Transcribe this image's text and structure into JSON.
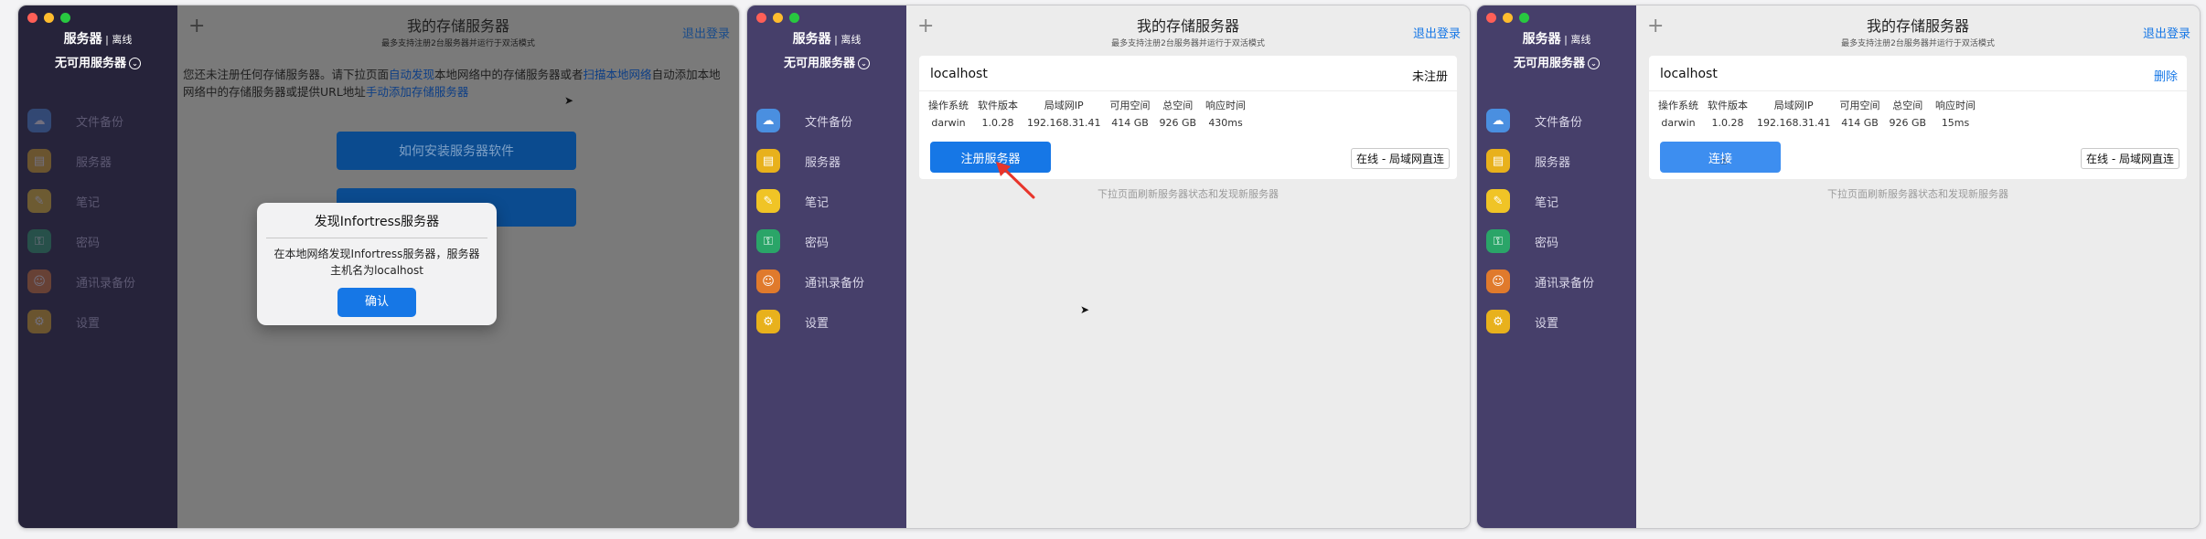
{
  "common": {
    "title": "我的存储服务器",
    "subtitle": "最多支持注册2台服务器并运行于双活模式",
    "logout": "退出登录",
    "plus": "+",
    "sidebar_name": "服务器",
    "sidebar_status": "离线",
    "no_server": "无可用服务器",
    "menu": [
      {
        "label": "文件备份",
        "icon": "file-backup-icon",
        "glyph": "☁"
      },
      {
        "label": "服务器",
        "icon": "server-icon",
        "glyph": "▤"
      },
      {
        "label": "笔记",
        "icon": "note-icon",
        "glyph": "✎"
      },
      {
        "label": "密码",
        "icon": "password-icon",
        "glyph": "⚿"
      },
      {
        "label": "通讯录备份",
        "icon": "contacts-icon",
        "glyph": "☺"
      },
      {
        "label": "设置",
        "icon": "settings-icon",
        "glyph": "⚙"
      }
    ],
    "stats_labels": [
      "操作系统",
      "软件版本",
      "局域网IP",
      "可用空间",
      "总空间",
      "响应时间"
    ],
    "pull_hint": "下拉页面刷新服务器状态和发现新服务器"
  },
  "panel1": {
    "notice_a": "您还未注册任何存储服务器。请下拉页面",
    "link_auto": "自动发现",
    "notice_b": "本地网络中的存储服务器或者",
    "link_scan": "扫描本地网络",
    "notice_c": "自动添加本地网络中的存储服务器或提供URL地址",
    "link_manual": "手动添加存储服务器",
    "btn_install": "如何安装服务器软件",
    "btn_second": "",
    "dialog": {
      "title": "发现Infortress服务器",
      "message": "在本地网络发现Infortress服务器，服务器主机名为localhost",
      "confirm": "确认"
    }
  },
  "panel2": {
    "host": "localhost",
    "state": "未注册",
    "stats": [
      "darwin",
      "1.0.28",
      "192.168.31.41",
      "414 GB",
      "926 GB",
      "430ms"
    ],
    "action": "注册服务器",
    "conn": "在线 - 局域网直连"
  },
  "panel3": {
    "host": "localhost",
    "state": "删除",
    "stats": [
      "darwin",
      "1.0.28",
      "192.168.31.41",
      "414 GB",
      "926 GB",
      "15ms"
    ],
    "action": "连接",
    "conn": "在线 - 局域网直连"
  },
  "colors": {
    "accent": "#1677e6",
    "sidebar": "#463f6a",
    "annotation_arrow": "#e8352b"
  }
}
